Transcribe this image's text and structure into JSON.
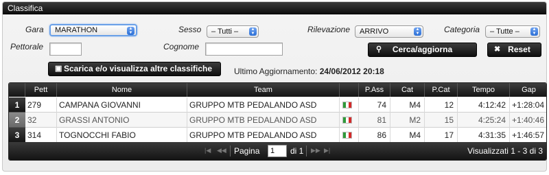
{
  "panel": {
    "title": "Classifica"
  },
  "filters": {
    "gara": {
      "label": "Gara",
      "value": "MARATHON"
    },
    "sesso": {
      "label": "Sesso",
      "value": "– Tutti –"
    },
    "rilevazione": {
      "label": "Rilevazione",
      "value": "ARRIVO"
    },
    "categoria": {
      "label": "Categoria",
      "value": "– Tutte –"
    },
    "pettorale": {
      "label": "Pettorale",
      "value": ""
    },
    "cognome": {
      "label": "Cognome",
      "value": ""
    }
  },
  "buttons": {
    "search": "Cerca/aggiorna",
    "reset": "Reset",
    "download": "Scarica e/o visualizza altre classifiche"
  },
  "updated": {
    "label": "Ultimo Aggiornamento:",
    "value": "24/06/2012 20:18"
  },
  "table": {
    "columns": [
      "Pett",
      "Nome",
      "Team",
      "",
      "P.Ass",
      "Cat",
      "P.Cat",
      "Tempo",
      "Gap"
    ],
    "rows": [
      {
        "rank": "1",
        "pett": "279",
        "nome": "CAMPANA GIOVANNI",
        "team": "GRUPPO MTB PEDALANDO ASD",
        "pass": "74",
        "cat": "M4",
        "pcat": "12",
        "tempo": "4:12:42",
        "gap": "+1:28:04"
      },
      {
        "rank": "2",
        "pett": "32",
        "nome": "GRASSI ANTONIO",
        "team": "GRUPPO MTB PEDALANDO ASD",
        "pass": "81",
        "cat": "M2",
        "pcat": "15",
        "tempo": "4:25:24",
        "gap": "+1:40:46"
      },
      {
        "rank": "3",
        "pett": "314",
        "nome": "TOGNOCCHI FABIO",
        "team": "GRUPPO MTB PEDALANDO ASD",
        "pass": "86",
        "cat": "M4",
        "pcat": "17",
        "tempo": "4:31:35",
        "gap": "+1:46:57"
      }
    ],
    "flag_colors": [
      "#2e9a3a",
      "#ffffff",
      "#d42a2a"
    ]
  },
  "pager": {
    "page_label": "Pagina",
    "page_value": "1",
    "of_label": "di 1",
    "summary": "Visualizzati 1 - 3 di 3"
  }
}
